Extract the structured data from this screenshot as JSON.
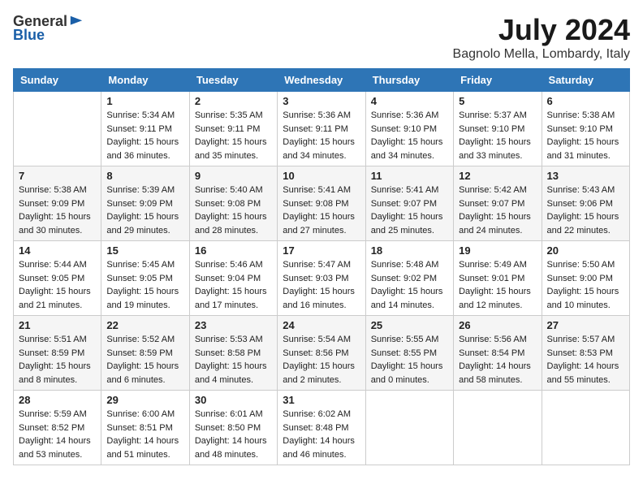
{
  "header": {
    "logo": {
      "text_general": "General",
      "text_blue": "Blue"
    },
    "month": "July 2024",
    "location": "Bagnolo Mella, Lombardy, Italy"
  },
  "weekdays": [
    "Sunday",
    "Monday",
    "Tuesday",
    "Wednesday",
    "Thursday",
    "Friday",
    "Saturday"
  ],
  "weeks": [
    [
      {
        "day": "",
        "sunrise": "",
        "sunset": "",
        "daylight": ""
      },
      {
        "day": "1",
        "sunrise": "Sunrise: 5:34 AM",
        "sunset": "Sunset: 9:11 PM",
        "daylight": "Daylight: 15 hours and 36 minutes."
      },
      {
        "day": "2",
        "sunrise": "Sunrise: 5:35 AM",
        "sunset": "Sunset: 9:11 PM",
        "daylight": "Daylight: 15 hours and 35 minutes."
      },
      {
        "day": "3",
        "sunrise": "Sunrise: 5:36 AM",
        "sunset": "Sunset: 9:11 PM",
        "daylight": "Daylight: 15 hours and 34 minutes."
      },
      {
        "day": "4",
        "sunrise": "Sunrise: 5:36 AM",
        "sunset": "Sunset: 9:10 PM",
        "daylight": "Daylight: 15 hours and 34 minutes."
      },
      {
        "day": "5",
        "sunrise": "Sunrise: 5:37 AM",
        "sunset": "Sunset: 9:10 PM",
        "daylight": "Daylight: 15 hours and 33 minutes."
      },
      {
        "day": "6",
        "sunrise": "Sunrise: 5:38 AM",
        "sunset": "Sunset: 9:10 PM",
        "daylight": "Daylight: 15 hours and 31 minutes."
      }
    ],
    [
      {
        "day": "7",
        "sunrise": "Sunrise: 5:38 AM",
        "sunset": "Sunset: 9:09 PM",
        "daylight": "Daylight: 15 hours and 30 minutes."
      },
      {
        "day": "8",
        "sunrise": "Sunrise: 5:39 AM",
        "sunset": "Sunset: 9:09 PM",
        "daylight": "Daylight: 15 hours and 29 minutes."
      },
      {
        "day": "9",
        "sunrise": "Sunrise: 5:40 AM",
        "sunset": "Sunset: 9:08 PM",
        "daylight": "Daylight: 15 hours and 28 minutes."
      },
      {
        "day": "10",
        "sunrise": "Sunrise: 5:41 AM",
        "sunset": "Sunset: 9:08 PM",
        "daylight": "Daylight: 15 hours and 27 minutes."
      },
      {
        "day": "11",
        "sunrise": "Sunrise: 5:41 AM",
        "sunset": "Sunset: 9:07 PM",
        "daylight": "Daylight: 15 hours and 25 minutes."
      },
      {
        "day": "12",
        "sunrise": "Sunrise: 5:42 AM",
        "sunset": "Sunset: 9:07 PM",
        "daylight": "Daylight: 15 hours and 24 minutes."
      },
      {
        "day": "13",
        "sunrise": "Sunrise: 5:43 AM",
        "sunset": "Sunset: 9:06 PM",
        "daylight": "Daylight: 15 hours and 22 minutes."
      }
    ],
    [
      {
        "day": "14",
        "sunrise": "Sunrise: 5:44 AM",
        "sunset": "Sunset: 9:05 PM",
        "daylight": "Daylight: 15 hours and 21 minutes."
      },
      {
        "day": "15",
        "sunrise": "Sunrise: 5:45 AM",
        "sunset": "Sunset: 9:05 PM",
        "daylight": "Daylight: 15 hours and 19 minutes."
      },
      {
        "day": "16",
        "sunrise": "Sunrise: 5:46 AM",
        "sunset": "Sunset: 9:04 PM",
        "daylight": "Daylight: 15 hours and 17 minutes."
      },
      {
        "day": "17",
        "sunrise": "Sunrise: 5:47 AM",
        "sunset": "Sunset: 9:03 PM",
        "daylight": "Daylight: 15 hours and 16 minutes."
      },
      {
        "day": "18",
        "sunrise": "Sunrise: 5:48 AM",
        "sunset": "Sunset: 9:02 PM",
        "daylight": "Daylight: 15 hours and 14 minutes."
      },
      {
        "day": "19",
        "sunrise": "Sunrise: 5:49 AM",
        "sunset": "Sunset: 9:01 PM",
        "daylight": "Daylight: 15 hours and 12 minutes."
      },
      {
        "day": "20",
        "sunrise": "Sunrise: 5:50 AM",
        "sunset": "Sunset: 9:00 PM",
        "daylight": "Daylight: 15 hours and 10 minutes."
      }
    ],
    [
      {
        "day": "21",
        "sunrise": "Sunrise: 5:51 AM",
        "sunset": "Sunset: 8:59 PM",
        "daylight": "Daylight: 15 hours and 8 minutes."
      },
      {
        "day": "22",
        "sunrise": "Sunrise: 5:52 AM",
        "sunset": "Sunset: 8:59 PM",
        "daylight": "Daylight: 15 hours and 6 minutes."
      },
      {
        "day": "23",
        "sunrise": "Sunrise: 5:53 AM",
        "sunset": "Sunset: 8:58 PM",
        "daylight": "Daylight: 15 hours and 4 minutes."
      },
      {
        "day": "24",
        "sunrise": "Sunrise: 5:54 AM",
        "sunset": "Sunset: 8:56 PM",
        "daylight": "Daylight: 15 hours and 2 minutes."
      },
      {
        "day": "25",
        "sunrise": "Sunrise: 5:55 AM",
        "sunset": "Sunset: 8:55 PM",
        "daylight": "Daylight: 15 hours and 0 minutes."
      },
      {
        "day": "26",
        "sunrise": "Sunrise: 5:56 AM",
        "sunset": "Sunset: 8:54 PM",
        "daylight": "Daylight: 14 hours and 58 minutes."
      },
      {
        "day": "27",
        "sunrise": "Sunrise: 5:57 AM",
        "sunset": "Sunset: 8:53 PM",
        "daylight": "Daylight: 14 hours and 55 minutes."
      }
    ],
    [
      {
        "day": "28",
        "sunrise": "Sunrise: 5:59 AM",
        "sunset": "Sunset: 8:52 PM",
        "daylight": "Daylight: 14 hours and 53 minutes."
      },
      {
        "day": "29",
        "sunrise": "Sunrise: 6:00 AM",
        "sunset": "Sunset: 8:51 PM",
        "daylight": "Daylight: 14 hours and 51 minutes."
      },
      {
        "day": "30",
        "sunrise": "Sunrise: 6:01 AM",
        "sunset": "Sunset: 8:50 PM",
        "daylight": "Daylight: 14 hours and 48 minutes."
      },
      {
        "day": "31",
        "sunrise": "Sunrise: 6:02 AM",
        "sunset": "Sunset: 8:48 PM",
        "daylight": "Daylight: 14 hours and 46 minutes."
      },
      {
        "day": "",
        "sunrise": "",
        "sunset": "",
        "daylight": ""
      },
      {
        "day": "",
        "sunrise": "",
        "sunset": "",
        "daylight": ""
      },
      {
        "day": "",
        "sunrise": "",
        "sunset": "",
        "daylight": ""
      }
    ]
  ]
}
